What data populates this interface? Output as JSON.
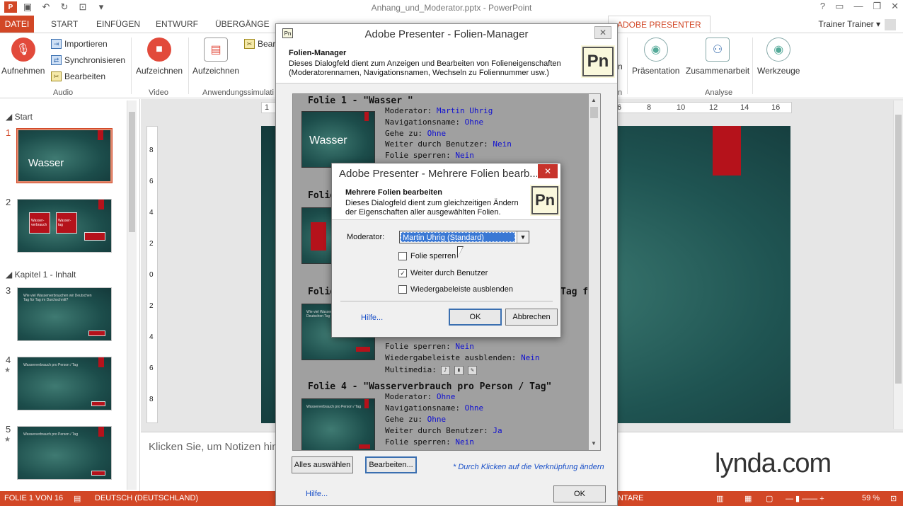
{
  "window": {
    "title": "Anhang_und_Moderator.pptx - PowerPoint",
    "app_icon": "P",
    "user": "Trainer Trainer"
  },
  "tabs": [
    {
      "label": "DATEI"
    },
    {
      "label": "START"
    },
    {
      "label": "EINFÜGEN"
    },
    {
      "label": "ENTWURF"
    },
    {
      "label": "ÜBERGÄNGE"
    },
    {
      "label": "ADOBE PRESENTER"
    }
  ],
  "ribbon": {
    "audio": {
      "aufnehmen": "Aufnehmen",
      "importieren": "Importieren",
      "synchronisieren": "Synchronisieren",
      "bearbeiten": "Bearbeiten",
      "group": "Audio"
    },
    "video": {
      "aufzeichnen": "Aufzeichnen",
      "group": "Video"
    },
    "anwendung": {
      "aufzeichnen": "Aufzeichnen",
      "bearb": "Bearb",
      "group": "Anwendungssimulati"
    },
    "right": {
      "n": "n",
      "praesentation": "Präsentation",
      "zusammenarbeit": "Zusammenarbeit",
      "werkzeuge": "Werkzeuge",
      "analyse": "Analyse"
    }
  },
  "slidepanel": {
    "section1": "Start",
    "section2": "Kapitel 1 - Inhalt",
    "slides": [
      {
        "num": "1",
        "title": "Wasser"
      },
      {
        "num": "2",
        "box1": "Wasser-verbrauch",
        "box2": "Wasser-tag"
      },
      {
        "num": "3",
        "text": "Wie viel Wasserverbrauchen wir Deutschen Tag für Tag im Durchschnitt?"
      },
      {
        "num": "4",
        "text": "Wasserverbrauch pro Person / Tag",
        "star": "★"
      },
      {
        "num": "5",
        "text": "Wasserverbrauch pro Person / Tag",
        "star": "★"
      }
    ]
  },
  "editor": {
    "notes_placeholder": "Klicken Sie, um Notizen hinz",
    "ruler_left": "1",
    "ruler_right_ticks": [
      "6",
      "8",
      "10",
      "12",
      "14",
      "16"
    ],
    "ruler_v_ticks": [
      "8",
      "6",
      "4",
      "2",
      "0",
      "2",
      "4",
      "6",
      "8"
    ]
  },
  "statusbar": {
    "slide_info": "FOLIE 1 VON 16",
    "language": "DEUTSCH (DEUTSCHLAND)",
    "notes_part": "NTARE",
    "zoom": "59 %"
  },
  "folien_manager": {
    "title": "Adobe Presenter - Folien-Manager",
    "heading": "Folien-Manager",
    "description": "Dieses Dialogfeld dient zum Anzeigen und Bearbeiten von Folieneigenschaften (Moderatorennamen, Navigationsnamen, Wechseln zu Foliennummer usw.)",
    "logo": "Pn",
    "labels": {
      "moderator": "Moderator:",
      "navigationsname": "Navigationsname:",
      "gehe_zu": "Gehe zu:",
      "weiter": "Weiter durch Benutzer:",
      "sperren": "Folie sperren:",
      "wiedergabe": "Wiedergabeleiste ausblenden:",
      "multimedia": "Multimedia:"
    },
    "slides": [
      {
        "title": "Folie 1 - \"Wasser \"",
        "thumb_title": "Wasser",
        "moderator": "Martin Uhrig",
        "navigationsname": "Ohne",
        "gehe_zu": "Ohne",
        "weiter": "Nein",
        "sperren": "Nein"
      },
      {
        "title": "Folie"
      },
      {
        "title": "Folie",
        "title_tail": "Tag fü",
        "sperren": "Nein",
        "wiedergabe": "Nein",
        "thumb_text": "Wie viel Wasser verbrauchen wir Deutschen Tag für Tag"
      },
      {
        "title": "Folie 4 - \"Wasserverbrauch pro Person / Tag\"",
        "thumb_text": "Wasserverbrauch pro Person / Tag",
        "moderator": "Ohne",
        "navigationsname": "Ohne",
        "gehe_zu": "Ohne",
        "weiter": "Ja",
        "sperren": "Nein"
      }
    ],
    "buttons": {
      "alle": "Alles auswählen",
      "bearbeiten": "Bearbeiten...",
      "ok": "OK"
    },
    "hint": "* Durch Klicken auf die Verknüpfung ändern",
    "help": "Hilfe..."
  },
  "mehrere_folien": {
    "title": "Adobe Presenter - Mehrere Folien bearb...",
    "heading": "Mehrere Folien bearbeiten",
    "description": "Dieses Dialogfeld dient zum gleichzeitigen Ändern der Eigenschaften aller ausgewählten Folien.",
    "logo": "Pn",
    "moderator_label": "Moderator:",
    "moderator_value": "Martin Uhrig (Standard)",
    "checkboxes": [
      {
        "label": "Folie sperren",
        "checked": false
      },
      {
        "label": "Weiter durch Benutzer",
        "checked": true
      },
      {
        "label": "Wiedergabeleiste ausblenden",
        "checked": false
      }
    ],
    "help": "Hilfe...",
    "ok": "OK",
    "cancel": "Abbrechen"
  },
  "watermark": "lynda.com",
  "colors": {
    "accent": "#d24726",
    "link": "#1a50c8",
    "slide_red": "#b5121b",
    "slide_teal": "#1f5452"
  }
}
